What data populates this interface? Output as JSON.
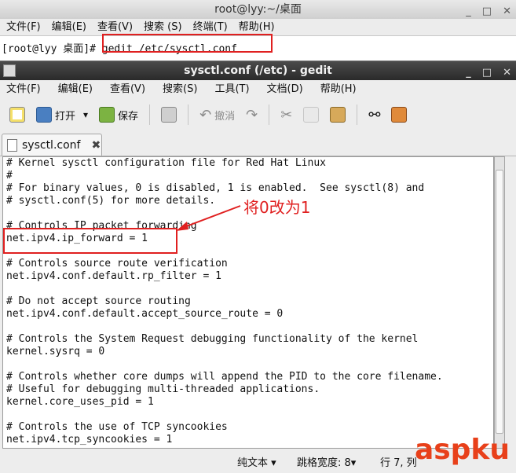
{
  "terminal": {
    "title": "root@lyy:~/桌面",
    "menu": [
      "文件(F)",
      "编辑(E)",
      "查看(V)",
      "搜索 (S)",
      "终端(T)",
      "帮助(H)"
    ],
    "prompt": "[root@lyy 桌面]#",
    "command": "gedit /etc/sysctl.conf"
  },
  "gedit": {
    "title": "sysctl.conf (/etc) - gedit",
    "menu": [
      "文件(F)",
      "编辑(E)",
      "查看(V)",
      "搜索(S)",
      "工具(T)",
      "文档(D)",
      "帮助(H)"
    ],
    "toolbar": {
      "open_label": "打开",
      "save_label": "保存",
      "undo_label": "撤消"
    },
    "tab_label": "sysctl.conf",
    "lines": [
      "# Kernel sysctl configuration file for Red Hat Linux",
      "#",
      "# For binary values, 0 is disabled, 1 is enabled.  See sysctl(8) and",
      "# sysctl.conf(5) for more details.",
      "",
      "# Controls IP packet forwarding",
      "net.ipv4.ip_forward = 1",
      "",
      "# Controls source route verification",
      "net.ipv4.conf.default.rp_filter = 1",
      "",
      "# Do not accept source routing",
      "net.ipv4.conf.default.accept_source_route = 0",
      "",
      "# Controls the System Request debugging functionality of the kernel",
      "kernel.sysrq = 0",
      "",
      "# Controls whether core dumps will append the PID to the core filename.",
      "# Useful for debugging multi-threaded applications.",
      "kernel.core_uses_pid = 1",
      "",
      "# Controls the use of TCP syncookies",
      "net.ipv4.tcp_syncookies = 1"
    ],
    "status": {
      "mode": "纯文本 ▾",
      "tab_width": "跳格宽度: 8▾",
      "position": "行 7, 列"
    }
  },
  "annotation": "将0改为1",
  "watermark": "aspku",
  "colors": {
    "highlight": "#e02020",
    "title_dark": "#2a2a2a"
  }
}
